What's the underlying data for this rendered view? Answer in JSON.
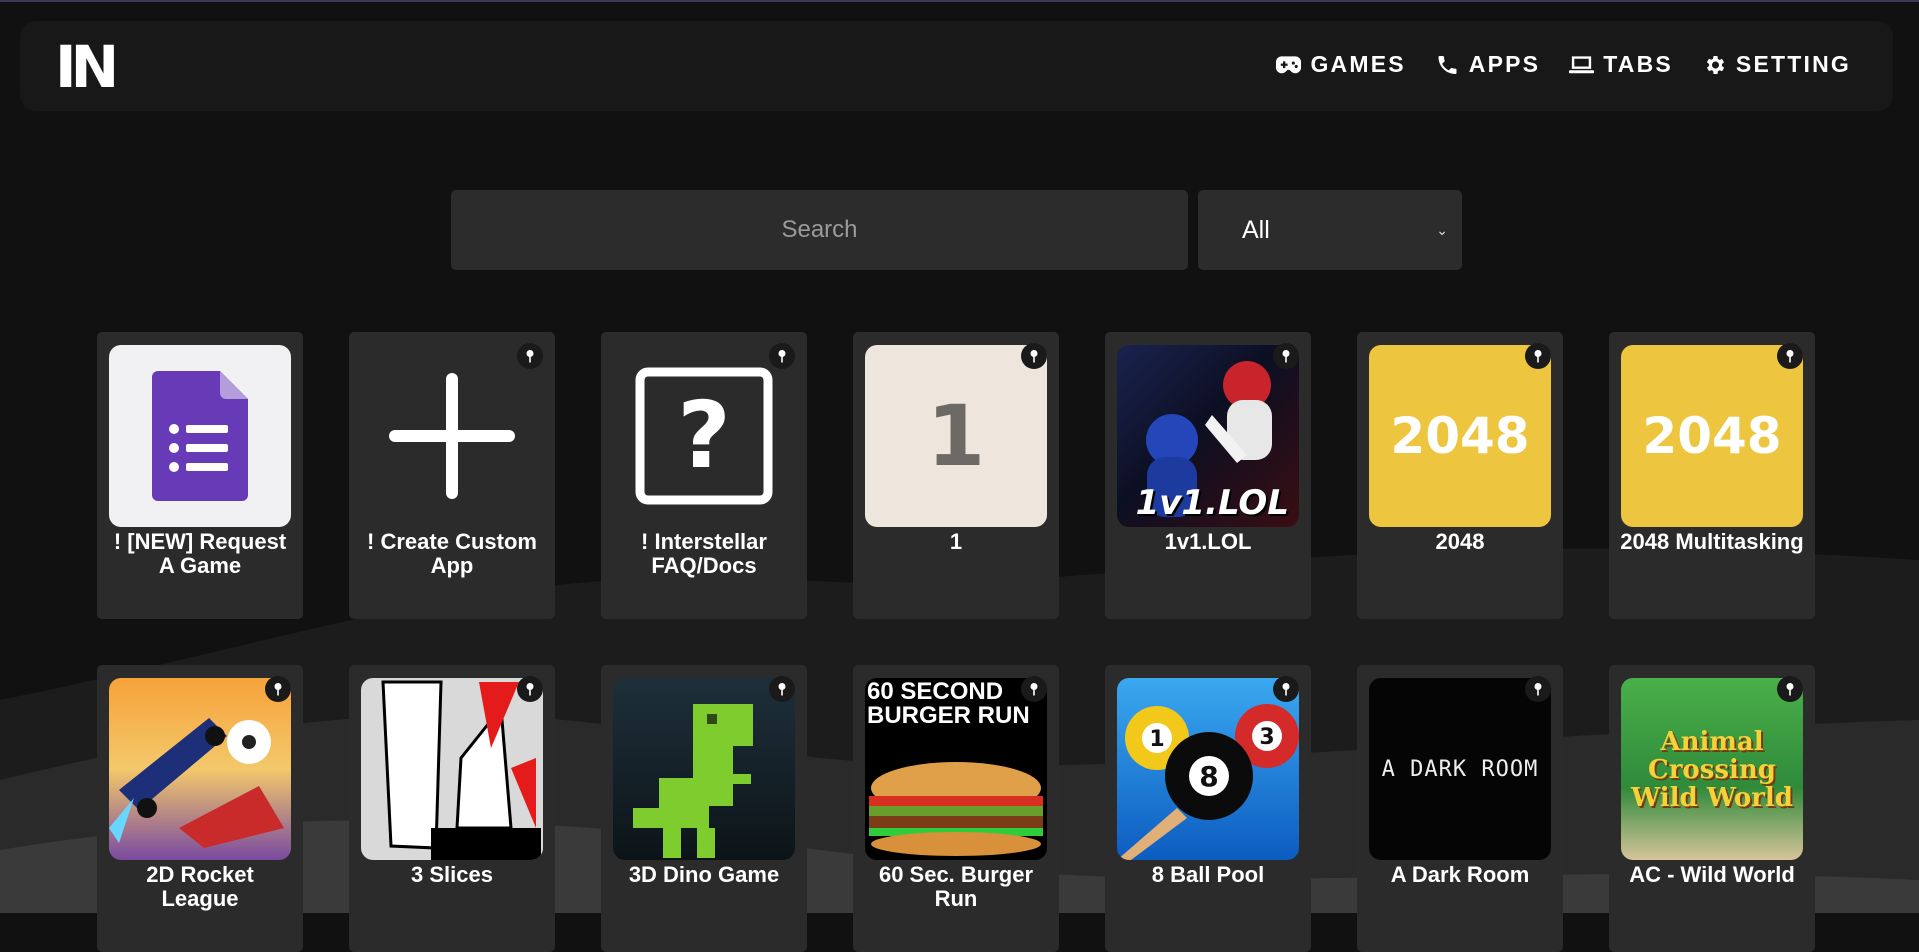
{
  "brand": {
    "logo_text": "IN"
  },
  "nav": {
    "items": [
      {
        "label": "GAMES",
        "icon": "gamepad-icon"
      },
      {
        "label": "APPS",
        "icon": "phone-icon"
      },
      {
        "label": "TABS",
        "icon": "laptop-icon"
      },
      {
        "label": "SETTING",
        "icon": "gear-icon"
      }
    ]
  },
  "search": {
    "placeholder": "Search",
    "value": ""
  },
  "filter": {
    "selected": "All"
  },
  "cards": [
    {
      "title": "! [NEW] Request A Game",
      "icon": "forms-icon",
      "pinnable": false
    },
    {
      "title": "! Create Custom App",
      "icon": "plus-icon",
      "pinnable": true
    },
    {
      "title": "! Interstellar FAQ/Docs",
      "icon": "question-box-icon",
      "pinnable": true
    },
    {
      "title": "1",
      "icon": "number-one-thumbnail",
      "thumb_text": "1",
      "pinnable": true
    },
    {
      "title": "1v1.LOL",
      "icon": "1v1-lol-thumbnail",
      "thumb_text": "1v1.LOL",
      "pinnable": true
    },
    {
      "title": "2048",
      "icon": "2048-thumbnail",
      "thumb_text": "2048",
      "pinnable": true
    },
    {
      "title": "2048 Multitasking",
      "icon": "2048-thumbnail",
      "thumb_text": "2048",
      "pinnable": true
    },
    {
      "title": "2D Rocket League",
      "icon": "rocket-league-thumbnail",
      "pinnable": true
    },
    {
      "title": "3 Slices",
      "icon": "3-slices-thumbnail",
      "pinnable": true
    },
    {
      "title": "3D Dino Game",
      "icon": "dino-thumbnail",
      "pinnable": true
    },
    {
      "title": "60 Sec. Burger Run",
      "icon": "burger-run-thumbnail",
      "thumb_text": "60 SECOND BURGER RUN",
      "pinnable": true
    },
    {
      "title": "8 Ball Pool",
      "icon": "8-ball-thumbnail",
      "pinnable": true
    },
    {
      "title": "A Dark Room",
      "icon": "dark-room-thumbnail",
      "thumb_text": "A DARK ROOM",
      "pinnable": true
    },
    {
      "title": "AC - Wild World",
      "icon": "animal-crossing-thumbnail",
      "thumb_text": "Animal Crossing Wild World",
      "pinnable": true
    }
  ],
  "colors": {
    "background": "#111111",
    "navbar": "#181818",
    "card": "#2b2b2b",
    "input": "#2c2c2c",
    "tile_2048": "#edc53f",
    "forms_purple": "#673ab7"
  }
}
